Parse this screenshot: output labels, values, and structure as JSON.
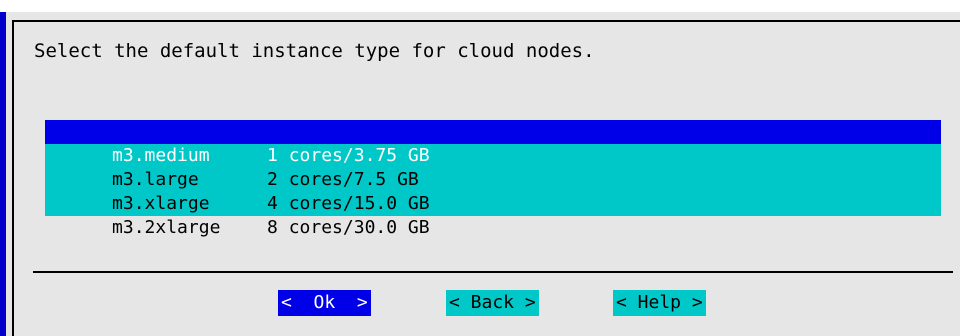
{
  "dialog": {
    "prompt": "Select the default instance type for cloud nodes."
  },
  "list": {
    "items": [
      {
        "name": "m3.medium",
        "spec": "1 cores/3.75 GB",
        "selected": true
      },
      {
        "name": "m3.large",
        "spec": "2 cores/7.5 GB",
        "selected": false
      },
      {
        "name": "m3.xlarge",
        "spec": "4 cores/15.0 GB",
        "selected": false
      },
      {
        "name": "m3.2xlarge",
        "spec": "8 cores/30.0 GB",
        "selected": false
      }
    ]
  },
  "buttons": {
    "ok_label": "<  Ok  >",
    "back_label": "< Back >",
    "help_label": "< Help >"
  },
  "colors": {
    "selection": "#0000e8",
    "list_background": "#00c8c8",
    "dialog_background": "#e6e6e6",
    "screen_background": "#0000c8"
  }
}
